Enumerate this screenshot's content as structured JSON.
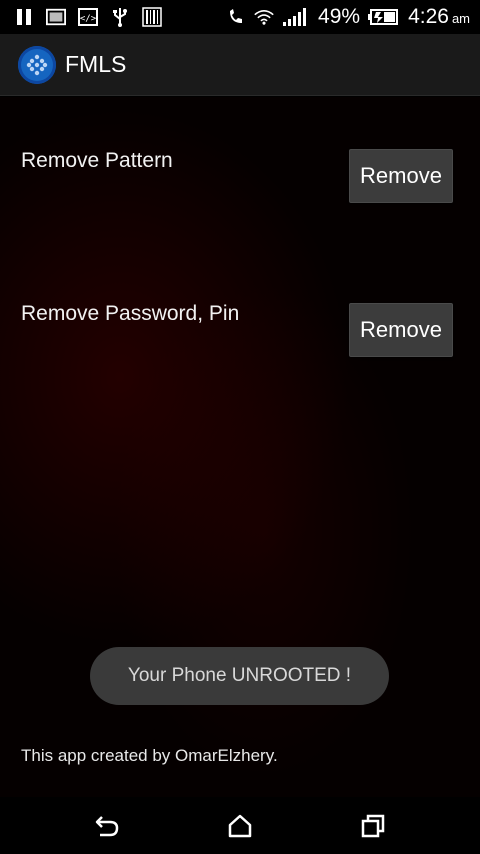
{
  "status_bar": {
    "battery_percent": "49%",
    "time": "4:26",
    "ampm": "am",
    "icons": [
      "pause-icon",
      "image-icon",
      "code-icon",
      "usb-icon",
      "barcode-icon",
      "phone-missed-icon",
      "wifi-icon",
      "signal-icon",
      "battery-charging-icon"
    ]
  },
  "app_bar": {
    "title": "FMLS",
    "logo_icon": "app-logo-icon"
  },
  "settings": {
    "items": [
      {
        "label": "Remove Pattern",
        "button_label": "Remove"
      },
      {
        "label": "Remove Password, Pin",
        "button_label": "Remove"
      }
    ]
  },
  "toast": {
    "message": "Your Phone UNROOTED !"
  },
  "footer": {
    "credit": "This app created by OmarElzhery."
  },
  "nav_bar": {
    "icons": [
      "back-icon",
      "home-icon",
      "recent-apps-icon"
    ]
  },
  "colors": {
    "background": "#000000",
    "action_bar": "#1a1a1a",
    "button": "#3c3c3c",
    "toast": "#3a3a3a",
    "logo": "#1565c0"
  }
}
